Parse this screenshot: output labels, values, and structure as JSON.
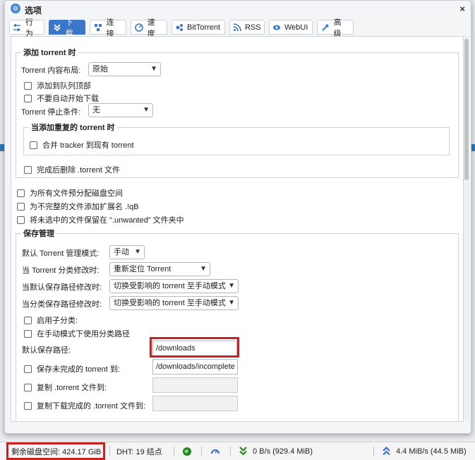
{
  "dialog": {
    "title": "选项",
    "close_label": "×"
  },
  "tabs": [
    {
      "label": "行为",
      "icon": "sliders-icon"
    },
    {
      "label": "下载",
      "icon": "download-icon",
      "active": true
    },
    {
      "label": "连接",
      "icon": "network-icon"
    },
    {
      "label": "速度",
      "icon": "speedometer-icon"
    },
    {
      "label": "BitTorrent",
      "icon": "bittorrent-icon"
    },
    {
      "label": "RSS",
      "icon": "rss-icon"
    },
    {
      "label": "WebUI",
      "icon": "webui-icon"
    },
    {
      "label": "高级",
      "icon": "wrench-icon"
    }
  ],
  "add_torrent": {
    "legend": "添加 torrent 时",
    "layout_label": "Torrent 内容布局:",
    "layout_value": "原始",
    "add_top_label": "添加到队列顶部",
    "no_autostart_label": "不要自动开始下载",
    "stop_condition_label": "Torrent 停止条件:",
    "stop_condition_value": "无",
    "duplicate": {
      "legend": "当添加重复的 torrent 时",
      "merge_trackers_label": "合并 tracker 到现有 torrent"
    },
    "delete_after_label": "完成后删除 .torrent 文件"
  },
  "general": {
    "prealloc_label": "为所有文件预分配磁盘空间",
    "append_ext_label": "为不完整的文件添加扩展名 .!qB",
    "unwanted_folder_label": "将未选中的文件保留在 \".unwanted\" 文件夹中"
  },
  "save_mgmt": {
    "legend": "保存管理",
    "default_mode_label": "默认 Torrent 管理模式:",
    "default_mode_value": "手动",
    "category_changed_label": "当 Torrent 分类修改时:",
    "category_changed_value": "重新定位 Torrent",
    "default_path_changed_label": "当默认保存路径修改时:",
    "default_path_changed_value": "切换受影响的 torrent 至手动模式",
    "category_path_changed_label": "当分类保存路径修改时:",
    "category_path_changed_value": "切换受影响的 torrent 至手动模式",
    "subcategories_label": "启用子分类:",
    "use_category_paths_label": "在手动模式下使用分类路径",
    "default_save_path_label": "默认保存路径:",
    "default_save_path_value": "/downloads",
    "incomplete_label": "保存未完成的 torrent 到:",
    "incomplete_value": "/downloads/incomplete",
    "copy_torrent_label": "复制 .torrent 文件到:",
    "copy_finished_label": "复制下载完成的 .torrent 文件到:"
  },
  "statusbar": {
    "free_space": "剩余磁盘空间: 424.17 GiB",
    "dht": "DHT: 19 结点",
    "download_speed": "0 B/s (929.4 MiB)",
    "upload_speed": "4.4 MiB/s (44.5 MiB)"
  },
  "colors": {
    "accent": "#3b77c9",
    "highlight": "#cc1f1f",
    "status_green": "#1e8a1e"
  }
}
